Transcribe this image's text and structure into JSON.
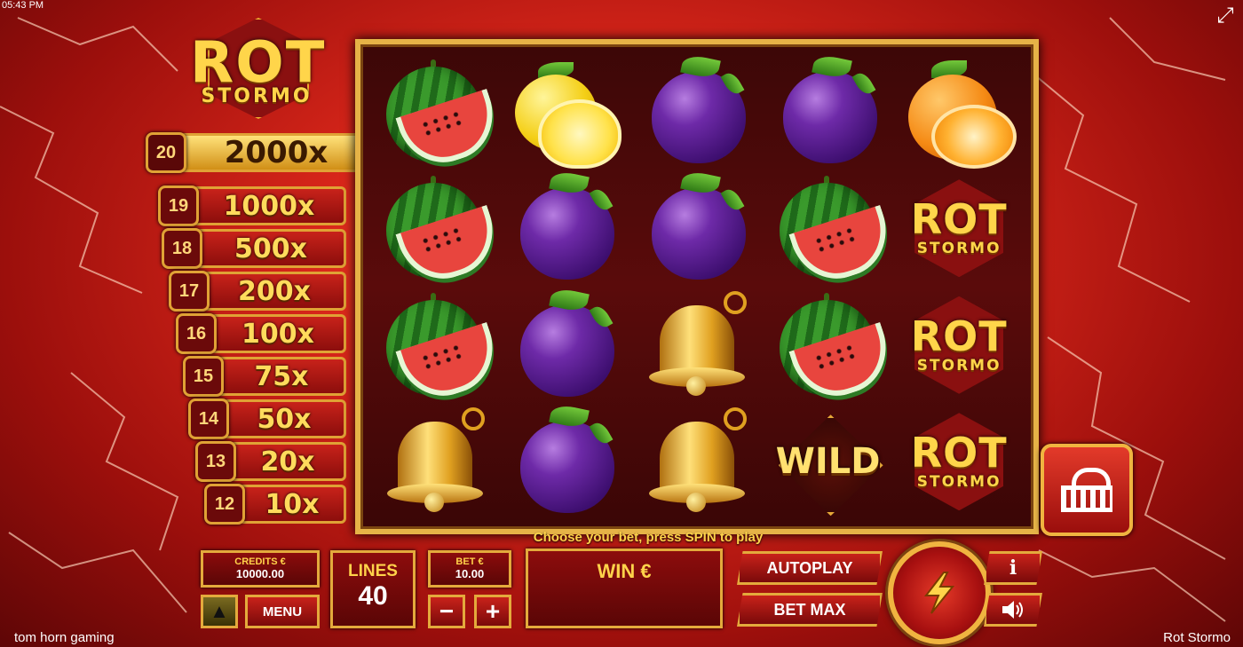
{
  "status_bar": {
    "time": "05:43 PM"
  },
  "logo": {
    "line1": "ROT",
    "line2": "STORMO"
  },
  "paytable": [
    {
      "lines": "20",
      "payout": "2000x"
    },
    {
      "lines": "19",
      "payout": "1000x"
    },
    {
      "lines": "18",
      "payout": "500x"
    },
    {
      "lines": "17",
      "payout": "200x"
    },
    {
      "lines": "16",
      "payout": "100x"
    },
    {
      "lines": "15",
      "payout": "75x"
    },
    {
      "lines": "14",
      "payout": "50x"
    },
    {
      "lines": "13",
      "payout": "20x"
    },
    {
      "lines": "12",
      "payout": "10x"
    }
  ],
  "reels": {
    "rows": [
      [
        "watermelon",
        "lemon",
        "plum",
        "plum",
        "orange"
      ],
      [
        "watermelon",
        "plum",
        "plum",
        "watermelon",
        "rot-stormo"
      ],
      [
        "watermelon",
        "plum",
        "bell",
        "watermelon",
        "rot-stormo"
      ],
      [
        "bell",
        "plum",
        "bell",
        "wild",
        "rot-stormo"
      ]
    ],
    "wild_label": "WILD",
    "rot_label_1": "ROT",
    "rot_label_2": "STORMO"
  },
  "instruction": "Choose your bet, press SPIN to play",
  "credits": {
    "label": "CREDITS €",
    "value": "10000.00"
  },
  "lines": {
    "label": "LINES",
    "value": "40"
  },
  "bet": {
    "label": "BET €",
    "value": "10.00"
  },
  "win": {
    "label": "WIN €"
  },
  "buttons": {
    "menu": "MENU",
    "autoplay": "AUTOPLAY",
    "betmax": "BET MAX",
    "minus": "−",
    "plus": "+",
    "info": "i"
  },
  "icons": {
    "fullscreen": "fullscreen-icon",
    "basket": "basket-icon",
    "spin": "lightning-icon",
    "sound": "speaker-icon",
    "up": "arrow-up-icon"
  },
  "footer": {
    "provider": "tom horn gaming",
    "game": "Rot Stormo"
  }
}
